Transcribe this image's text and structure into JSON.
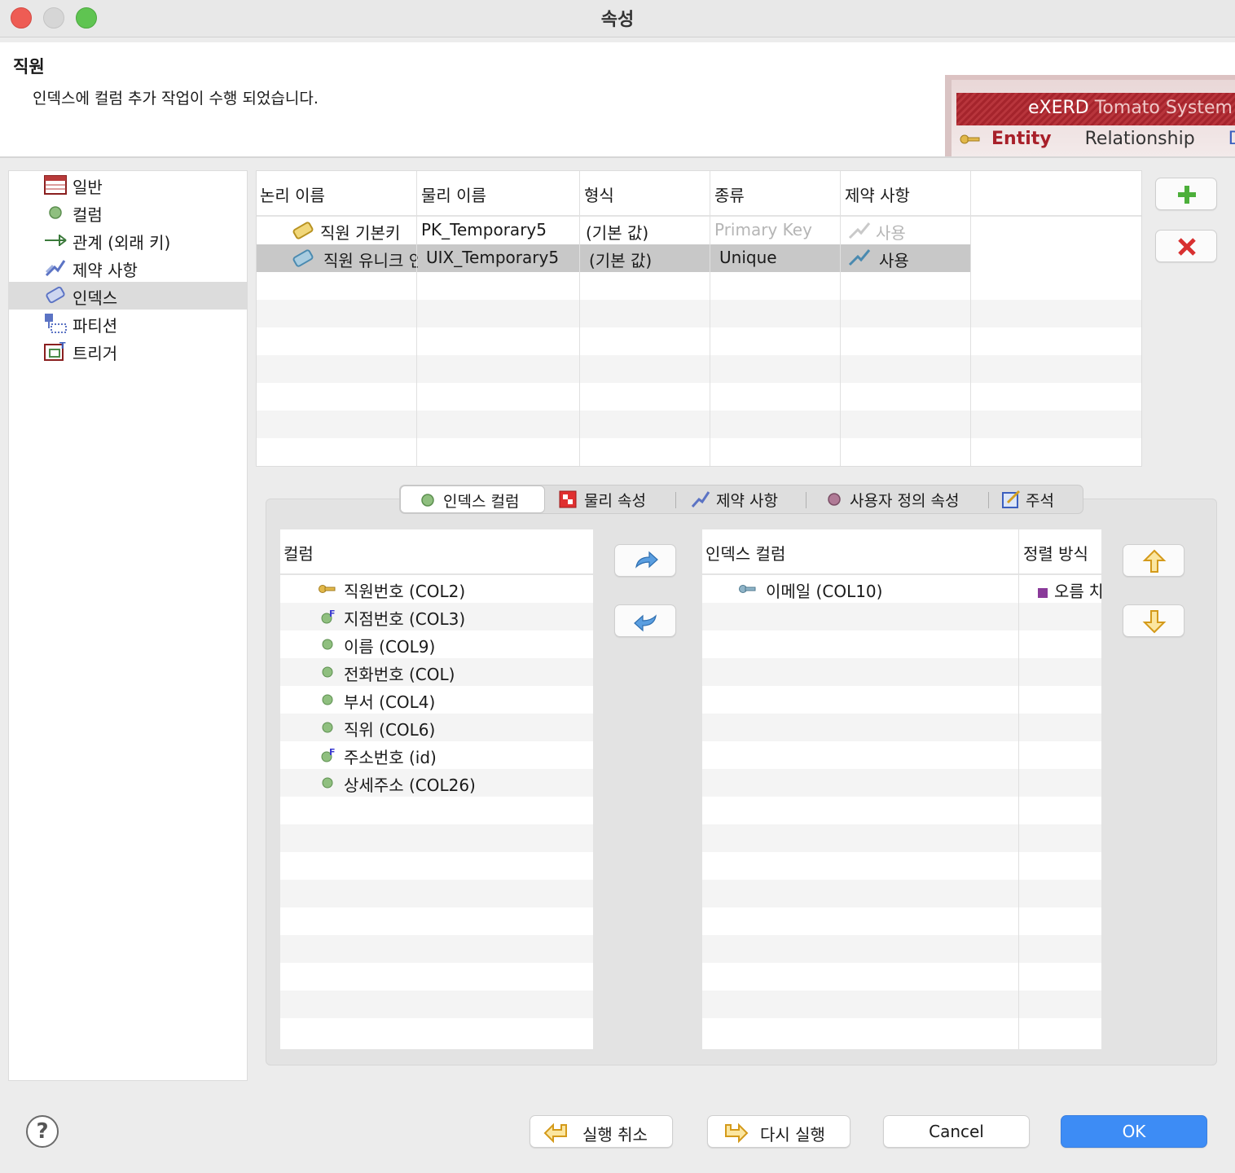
{
  "window": {
    "title": "속성"
  },
  "header": {
    "entity_name": "직원",
    "message": "인덱스에 컬럼 추가 작업이 수행 되었습니다.",
    "banner": {
      "brand": "eXERD",
      "system": "Tomato System",
      "nav": [
        "Entity",
        "Relationship",
        "Diag"
      ]
    }
  },
  "tree": {
    "items": [
      {
        "label": "일반",
        "icon": "table-icon"
      },
      {
        "label": "컬럼",
        "icon": "column-icon"
      },
      {
        "label": "관계 (외래 키)",
        "icon": "relationship-icon"
      },
      {
        "label": "제약 사항",
        "icon": "constraint-icon"
      },
      {
        "label": "인덱스",
        "icon": "index-icon",
        "selected": true
      },
      {
        "label": "파티션",
        "icon": "partition-icon"
      },
      {
        "label": "트리거",
        "icon": "trigger-icon"
      }
    ]
  },
  "index_table": {
    "headers": [
      "논리 이름",
      "물리 이름",
      "형식",
      "종류",
      "제약 사항"
    ],
    "rows": [
      {
        "logical": "직원 기본키",
        "physical": "PK_Temporary5",
        "format": "(기본 값)",
        "kind": "Primary Key",
        "constraint": "사용"
      },
      {
        "logical": "직원 유니크 인",
        "physical": "UIX_Temporary5",
        "format": "(기본 값)",
        "kind": "Unique",
        "constraint": "사용"
      }
    ]
  },
  "tabs": [
    {
      "label": "인덱스 컬럼",
      "icon": "column-dot-icon",
      "active": true
    },
    {
      "label": "물리 속성",
      "icon": "physical-icon"
    },
    {
      "label": "제약 사항",
      "icon": "constraint-icon"
    },
    {
      "label": "사용자 정의 속성",
      "icon": "custom-dot-icon"
    },
    {
      "label": "주석",
      "icon": "comment-icon"
    }
  ],
  "columns": {
    "header": "컬럼",
    "items": [
      {
        "label": "직원번호 (COL2)",
        "icon": "key-icon"
      },
      {
        "label": "지점번호 (COL3)",
        "icon": "foreign-key-icon"
      },
      {
        "label": "이름 (COL9)",
        "icon": "column-icon"
      },
      {
        "label": "전화번호 (COL)",
        "icon": "column-icon"
      },
      {
        "label": "부서 (COL4)",
        "icon": "column-icon"
      },
      {
        "label": "직위 (COL6)",
        "icon": "column-icon"
      },
      {
        "label": "주소번호 (id)",
        "icon": "foreign-key-icon"
      },
      {
        "label": "상세주소 (COL26)",
        "icon": "column-icon"
      }
    ]
  },
  "index_columns": {
    "header_column": "인덱스 컬럼",
    "header_sort": "정렬 방식",
    "items": [
      {
        "label": "이메일 (COL10)",
        "sort": "오름 차",
        "icon": "key-icon"
      }
    ]
  },
  "buttons": {
    "undo": "실행 취소",
    "redo": "다시 실행",
    "cancel": "Cancel",
    "ok": "OK",
    "help": "?"
  },
  "colors": {
    "accent": "#3d8cf5",
    "brand": "#a5242c",
    "add": "#4caf3a",
    "remove": "#d83030"
  }
}
